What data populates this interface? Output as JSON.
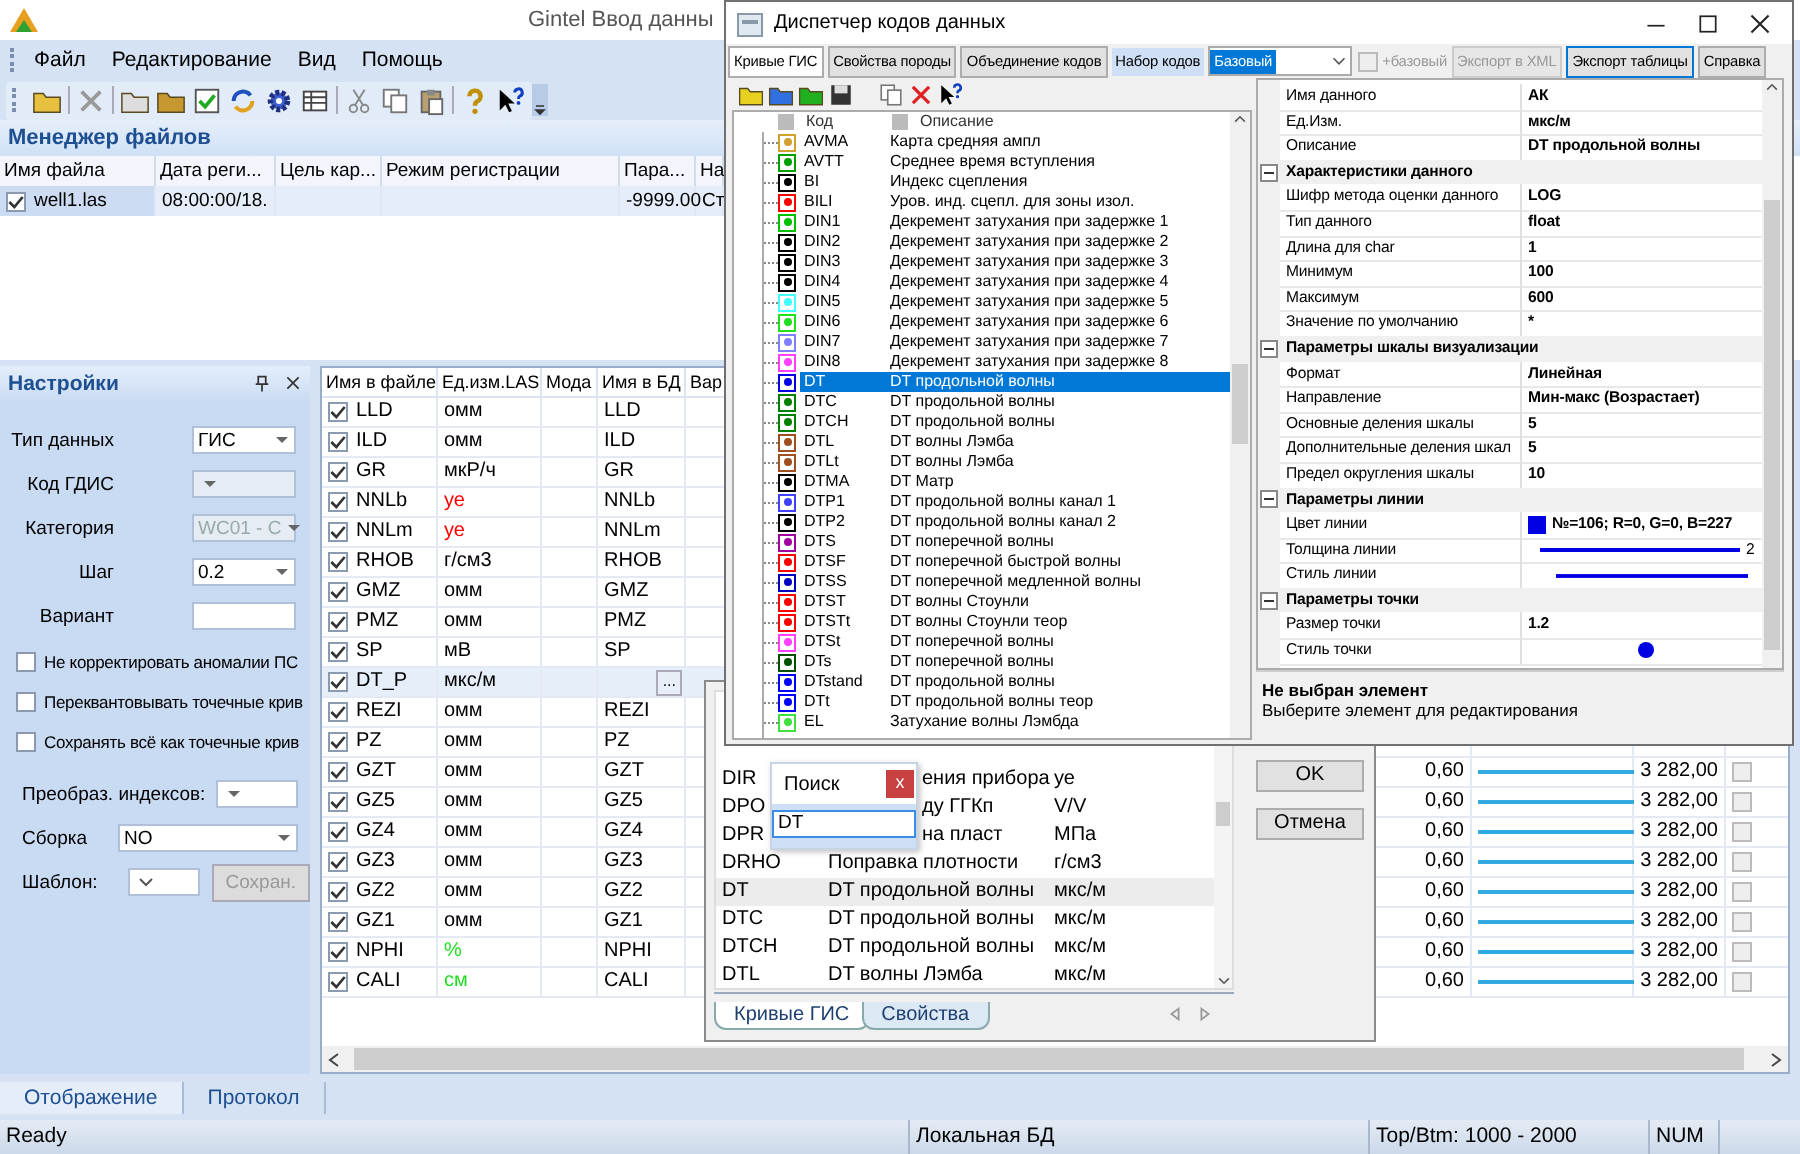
{
  "main_window": {
    "title": "Gintel  Ввод данны",
    "menu": [
      "Файл",
      "Редактирование",
      "Вид",
      "Помощь"
    ]
  },
  "file_manager": {
    "title": "Менеджер файлов",
    "columns": [
      "Имя файла",
      "Дата реги...",
      "Цель кар...",
      "Режим регистрации",
      "Пара...",
      "На"
    ],
    "rows": [
      {
        "file_name": "well1.las",
        "date": "08:00:00/18.",
        "parameter": "-9999.00",
        "column_6": "Ст",
        "checked": true,
        "selected": true
      }
    ]
  },
  "settings": {
    "title": "Настройки",
    "fields": [
      {
        "kind": "combo",
        "label": "Тип данных",
        "value": "ГИС",
        "disabled": false
      },
      {
        "kind": "combo",
        "label": "Код ГДИС",
        "disabled": true
      },
      {
        "kind": "combo",
        "label": "Категория",
        "value": "WC01 - C",
        "disabled": true
      },
      {
        "kind": "combo",
        "label": "Шаг",
        "value": "0.2",
        "disabled": false
      },
      {
        "kind": "text",
        "label": "Вариант"
      }
    ],
    "options": [
      {
        "label": "Не корректировать аномалии ПС",
        "checked": false
      },
      {
        "label": "Переквантовывать точечные крив",
        "checked": false
      },
      {
        "label": "Сохранять всё как точечные крив",
        "checked": false
      }
    ],
    "lower_fields": [
      {
        "kind": "combo",
        "label": "Преобраз. индексов:"
      },
      {
        "kind": "combo",
        "label": "Сборка",
        "value": "NO"
      },
      {
        "kind": "dropdown",
        "label": "Шаблон:",
        "button": "Сохран.",
        "button_disabled": true
      }
    ]
  },
  "curves_table": {
    "columns": [
      "Имя в файле",
      "Ед.изм.LAS",
      "Мода",
      "Имя в БД",
      "Вар"
    ],
    "rows": [
      {
        "name": "LLD",
        "unit": "омм",
        "color": "#000000",
        "db_name": "LLD",
        "checked": true,
        "selected": false
      },
      {
        "name": "ILD",
        "unit": "омм",
        "color": "#000000",
        "db_name": "ILD",
        "checked": true,
        "selected": false
      },
      {
        "name": "GR",
        "unit": "мкР/ч",
        "color": "#000000",
        "db_name": "GR",
        "checked": true,
        "selected": false
      },
      {
        "name": "NNLb",
        "unit": "уе",
        "color": "#ff0000",
        "db_name": "NNLb",
        "checked": true,
        "selected": false
      },
      {
        "name": "NNLm",
        "unit": "уе",
        "color": "#ff0000",
        "db_name": "NNLm",
        "checked": true,
        "selected": false
      },
      {
        "name": "RHOB",
        "unit": "г/см3",
        "color": "#000000",
        "db_name": "RHOB",
        "checked": true,
        "selected": false
      },
      {
        "name": "GMZ",
        "unit": "омм",
        "color": "#000000",
        "db_name": "GMZ",
        "checked": true,
        "selected": false
      },
      {
        "name": "PMZ",
        "unit": "омм",
        "color": "#000000",
        "db_name": "PMZ",
        "checked": true,
        "selected": false
      },
      {
        "name": "SP",
        "unit": "мВ",
        "color": "#000000",
        "db_name": "SP",
        "checked": true,
        "selected": false
      },
      {
        "name": "DT_P",
        "unit": "мкс/м",
        "color": "#000000",
        "edit_button": "...",
        "checked": true,
        "selected": true
      },
      {
        "name": "REZI",
        "unit": "омм",
        "color": "#000000",
        "db_name": "REZI",
        "checked": true,
        "selected": false
      },
      {
        "name": "PZ",
        "unit": "омм",
        "color": "#000000",
        "db_name": "PZ",
        "checked": true,
        "selected": false
      },
      {
        "name": "GZT",
        "unit": "омм",
        "color": "#000000",
        "db_name": "GZT",
        "checked": true,
        "selected": false,
        "column_7": "0,60",
        "column_9": "3 282,00",
        "column_10_checked": false
      },
      {
        "name": "GZ5",
        "unit": "омм",
        "color": "#000000",
        "db_name": "GZ5",
        "checked": true,
        "selected": false,
        "column_7": "0,60",
        "column_9": "3 282,00",
        "column_10_checked": false
      },
      {
        "name": "GZ4",
        "unit": "омм",
        "color": "#000000",
        "db_name": "GZ4",
        "checked": true,
        "selected": false,
        "column_7": "0,60",
        "column_9": "3 282,00",
        "column_10_checked": false
      },
      {
        "name": "GZ3",
        "unit": "омм",
        "color": "#000000",
        "db_name": "GZ3",
        "checked": true,
        "selected": false,
        "column_7": "0,60",
        "column_9": "3 282,00",
        "column_10_checked": false
      },
      {
        "name": "GZ2",
        "unit": "омм",
        "color": "#000000",
        "db_name": "GZ2",
        "checked": true,
        "selected": false,
        "column_7": "0,60",
        "column_9": "3 282,00",
        "column_10_checked": false
      },
      {
        "name": "GZ1",
        "unit": "омм",
        "color": "#000000",
        "db_name": "GZ1",
        "checked": true,
        "selected": false,
        "column_7": "0,60",
        "column_9": "3 282,00",
        "column_10_checked": false
      },
      {
        "name": "NPHI",
        "unit": "%",
        "color": "#22dd22",
        "db_name": "NPHI",
        "checked": true,
        "selected": false,
        "column_7": "0,60",
        "column_9": "3 282,00",
        "column_10_checked": false
      },
      {
        "name": "CALI",
        "unit": "см",
        "color": "#22dd22",
        "db_name": "CALI",
        "checked": true,
        "selected": false,
        "column_7": "0,60",
        "column_9": "3 282,00",
        "column_10_checked": false
      }
    ]
  },
  "bottom_tabs": [
    {
      "label": "Отображение",
      "selected": true
    },
    {
      "label": "Протокол",
      "selected": false
    }
  ],
  "status_bar": [
    "Ready",
    "Локальная БД",
    "Top/Btm: 1000 - 2000",
    "NUM"
  ],
  "codes_dialog": {
    "title": "Диспетчер кодов данных",
    "tabs": [
      {
        "label": "Кривые ГИС",
        "selected": true
      },
      {
        "label": "Свойства породы",
        "selected": false
      },
      {
        "label": "Объединение кодов",
        "selected": false
      }
    ],
    "code_set_label": "Набор кодов",
    "code_set_value": "Базовый",
    "base_checkbox": {
      "label": "+базовый",
      "checked": false,
      "disabled": true
    },
    "buttons": [
      {
        "label": "Экспорт в XML",
        "disabled": true
      },
      {
        "label": "Экспорт таблицы",
        "disabled": false
      },
      {
        "label": "Справка",
        "disabled": false
      }
    ],
    "tree_columns": [
      "Код",
      "Описание"
    ],
    "items": [
      {
        "code": "AVMA",
        "description": "Карта средняя ампл",
        "color": "#d0a030",
        "selected": false
      },
      {
        "code": "AVTT",
        "description": "Среднее время вступления",
        "color": "#00a000",
        "selected": false
      },
      {
        "code": "BI",
        "description": "Индекс сцепления",
        "color": "#000000",
        "selected": false
      },
      {
        "code": "BILI",
        "description": "Уров. инд. сцепл. для зоны изол.",
        "color": "#ff0000",
        "selected": false
      },
      {
        "code": "DIN1",
        "description": "Декремент затухания при задержке 1",
        "color": "#00c000",
        "selected": false
      },
      {
        "code": "DIN2",
        "description": "Декремент затухания при задержке 2",
        "color": "#000000",
        "selected": false
      },
      {
        "code": "DIN3",
        "description": "Декремент затухания при задержке 3",
        "color": "#000000",
        "selected": false
      },
      {
        "code": "DIN4",
        "description": "Декремент затухания при задержке 4",
        "color": "#000000",
        "selected": false
      },
      {
        "code": "DIN5",
        "description": "Декремент затухания при задержке 5",
        "color": "#40ffff",
        "selected": false
      },
      {
        "code": "DIN6",
        "description": "Декремент затухания при задержке 6",
        "color": "#20e020",
        "selected": false
      },
      {
        "code": "DIN7",
        "description": "Декремент затухания при задержке 7",
        "color": "#8080ff",
        "selected": false
      },
      {
        "code": "DIN8",
        "description": "Декремент затухания при задержке 8",
        "color": "#ff40ff",
        "selected": false
      },
      {
        "code": "DT",
        "description": "DT продольной волны",
        "color": "#0000e3",
        "selected": true
      },
      {
        "code": "DTC",
        "description": "DT продольной волны",
        "color": "#008000",
        "selected": false
      },
      {
        "code": "DTCH",
        "description": "DT продольной волны",
        "color": "#008000",
        "selected": false
      },
      {
        "code": "DTL",
        "description": "DT волны Лэмба",
        "color": "#a05020",
        "selected": false
      },
      {
        "code": "DTLt",
        "description": "DT волны Лэмба",
        "color": "#a05020",
        "selected": false
      },
      {
        "code": "DTMA",
        "description": "DT Матр",
        "color": "#000000",
        "selected": false
      },
      {
        "code": "DTP1",
        "description": "DT продольной волны канал 1",
        "color": "#4040ff",
        "selected": false
      },
      {
        "code": "DTP2",
        "description": "DT продольной волны канал 2",
        "color": "#000000",
        "selected": false
      },
      {
        "code": "DTS",
        "description": "DT поперечной волны",
        "color": "#a000a0",
        "selected": false
      },
      {
        "code": "DTSF",
        "description": "DT поперечной быстрой волны",
        "color": "#ff0000",
        "selected": false
      },
      {
        "code": "DTSS",
        "description": "DT поперечной медленной волны",
        "color": "#0000c0",
        "selected": false
      },
      {
        "code": "DTST",
        "description": "DT волны Стоунли",
        "color": "#ff0000",
        "selected": false
      },
      {
        "code": "DTSTt",
        "description": "DT волны Стоунли теор",
        "color": "#ff0000",
        "selected": false
      },
      {
        "code": "DTSt",
        "description": "DT поперечной волны",
        "color": "#ff40ff",
        "selected": false
      },
      {
        "code": "DTs",
        "description": "DT поперечной волны",
        "color": "#005000",
        "selected": false
      },
      {
        "code": "DTstand",
        "description": "DT продольной волны",
        "color": "#0000ff",
        "selected": false
      },
      {
        "code": "DTt",
        "description": "DT продольной волны теор",
        "color": "#0000ff",
        "selected": false
      },
      {
        "code": "EL",
        "description": "Затухание волны Лэмбда",
        "color": "#40e040",
        "selected": false
      }
    ],
    "properties": [
      {
        "kind": "value",
        "name": "Имя данного",
        "value": "АК"
      },
      {
        "kind": "value",
        "name": "Ед.Изм.",
        "value": "мкс/м"
      },
      {
        "kind": "value",
        "name": "Описание",
        "value": "DT продольной волны"
      },
      {
        "kind": "category",
        "name": "Характеристики данного",
        "expanded": true
      },
      {
        "kind": "value",
        "name": "Шифр метода оценки данного",
        "value": "LOG"
      },
      {
        "kind": "value",
        "name": "Тип данного",
        "value": "float"
      },
      {
        "kind": "value",
        "name": "Длина для char",
        "value": "1"
      },
      {
        "kind": "value",
        "name": "Минимум",
        "value": "100"
      },
      {
        "kind": "value",
        "name": "Максимум",
        "value": "600"
      },
      {
        "kind": "value",
        "name": "Значение по умолчанию",
        "value": "*"
      },
      {
        "kind": "category",
        "name": "Параметры шкалы визуализации",
        "expanded": true
      },
      {
        "kind": "value",
        "name": "Формат",
        "value": "Линейная"
      },
      {
        "kind": "value",
        "name": "Направление",
        "value": "Мин-макс (Возрастает)"
      },
      {
        "kind": "value",
        "name": "Основные деления шкалы",
        "value": "5"
      },
      {
        "kind": "value",
        "name": "Дополнительные деления шкал",
        "value": "5"
      },
      {
        "kind": "value",
        "name": "Предел округления шкалы",
        "value": "10"
      },
      {
        "kind": "category",
        "name": "Параметры линии",
        "expanded": true
      },
      {
        "kind": "color",
        "name": "Цвет линии",
        "value": "№=106; R=0, G=0, B=227",
        "color": "#0000e3"
      },
      {
        "kind": "line",
        "name": "Толщина линии",
        "value": "2"
      },
      {
        "kind": "line",
        "name": "Стиль линии"
      },
      {
        "kind": "category",
        "name": "Параметры точки",
        "expanded": true
      },
      {
        "kind": "value",
        "name": "Размер точки",
        "value": "1.2"
      },
      {
        "kind": "dot",
        "name": "Стиль точки"
      }
    ],
    "hint_title": "Не выбран элемент",
    "hint_text": "Выберите элемент для редактирования"
  },
  "curves_dialog": {
    "rows": [
      {
        "code": "DIR",
        "description": "ения прибора",
        "unit": "уе",
        "selected": false
      },
      {
        "code": "DPO",
        "description": "ду ГГКп",
        "unit": "V/V",
        "selected": false
      },
      {
        "code": "DPR",
        "description": "на пласт",
        "unit": "МПа",
        "selected": false
      },
      {
        "code": "DRHO",
        "description": "Поправка плотности",
        "unit": "г/см3",
        "selected": false
      },
      {
        "code": "DT",
        "description": "DT продольной волны",
        "unit": "мкс/м",
        "selected": true
      },
      {
        "code": "DTC",
        "description": "DT продольной волны",
        "unit": "мкс/м",
        "selected": false
      },
      {
        "code": "DTCH",
        "description": "DT продольной волны",
        "unit": "мкс/м",
        "selected": false
      },
      {
        "code": "DTL",
        "description": "DT волны Лэмба",
        "unit": "мкс/м",
        "selected": false
      }
    ],
    "tabs": [
      {
        "label": "Кривые ГИС",
        "selected": true
      },
      {
        "label": "Свойства",
        "selected": false
      }
    ],
    "buttons": [
      "OK",
      "Отмена"
    ]
  },
  "search_popup": {
    "title": "Поиск",
    "close": "x",
    "value": "DT"
  }
}
